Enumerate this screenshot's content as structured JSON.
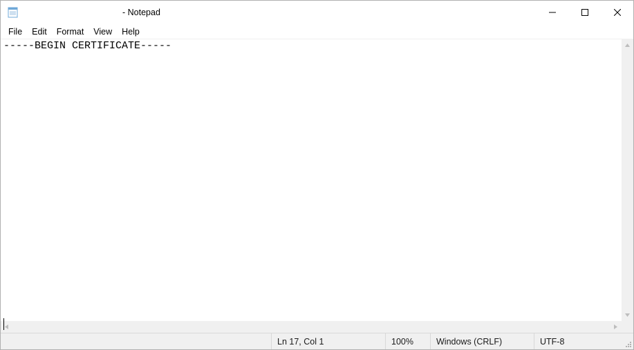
{
  "window": {
    "title": "- Notepad"
  },
  "menu": {
    "file": "File",
    "edit": "Edit",
    "format": "Format",
    "view": "View",
    "help": "Help"
  },
  "editor": {
    "content": "-----BEGIN CERTIFICATE-----"
  },
  "status": {
    "position": "Ln 17, Col 1",
    "zoom": "100%",
    "eol": "Windows (CRLF)",
    "encoding": "UTF-8"
  }
}
